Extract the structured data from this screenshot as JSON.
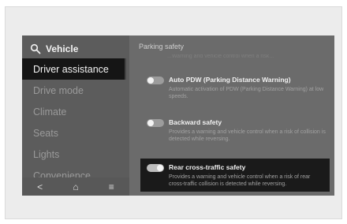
{
  "sidebar": {
    "header": "Vehicle",
    "items": [
      {
        "label": "Driver assistance"
      },
      {
        "label": "Drive mode"
      },
      {
        "label": "Climate"
      },
      {
        "label": "Seats"
      },
      {
        "label": "Lights"
      },
      {
        "label": "Convenience"
      }
    ],
    "bottom": {
      "back": "<",
      "home": "⌂",
      "menu": "≡"
    }
  },
  "content": {
    "title": "Parking safety",
    "faded_text": "...Warning and vehicle control when a risk...",
    "settings": [
      {
        "title": "Auto PDW (Parking Distance Warning)",
        "description": "Automatic activation of PDW (Parking Distance Warning) at low speeds.",
        "state": "off"
      },
      {
        "title": "Backward safety",
        "description": "Provides a warning and vehicle control when a risk of collision is detected while reversing.",
        "state": "off"
      },
      {
        "title": "Rear cross-traffic safety",
        "description": "Provides a warning and vehicle control when a risk of rear cross-traffic collision is detected while reversing.",
        "state": "on"
      }
    ]
  },
  "colors": {
    "screen_bg": "#6b6b6b",
    "active_bg": "#151515",
    "text_light": "#f2f2f2",
    "text_dim": "#a2a2a2"
  }
}
